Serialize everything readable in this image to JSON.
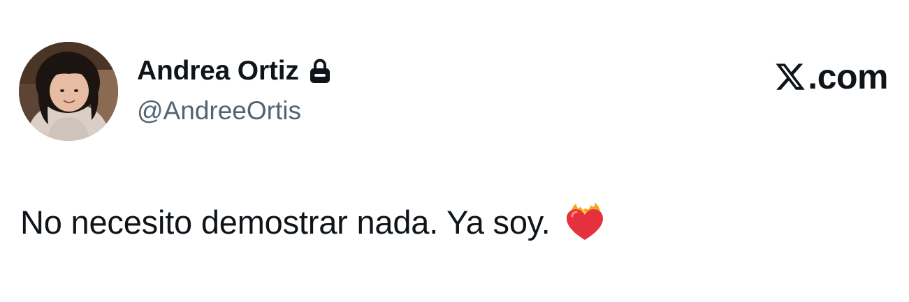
{
  "author": {
    "display_name": "Andrea Ortiz",
    "handle": "@AndreeOrtis",
    "protected_icon": "lock-icon",
    "avatar": "child-photo-avatar"
  },
  "brand": {
    "logo_icon": "x-logo-icon",
    "suffix": ".com"
  },
  "tweet": {
    "text": "No necesito demostrar nada. Ya soy.",
    "emoji_icon": "heart-on-fire-icon"
  },
  "colors": {
    "text_primary": "#0f1419",
    "text_secondary": "#536471",
    "background": "#ffffff"
  }
}
